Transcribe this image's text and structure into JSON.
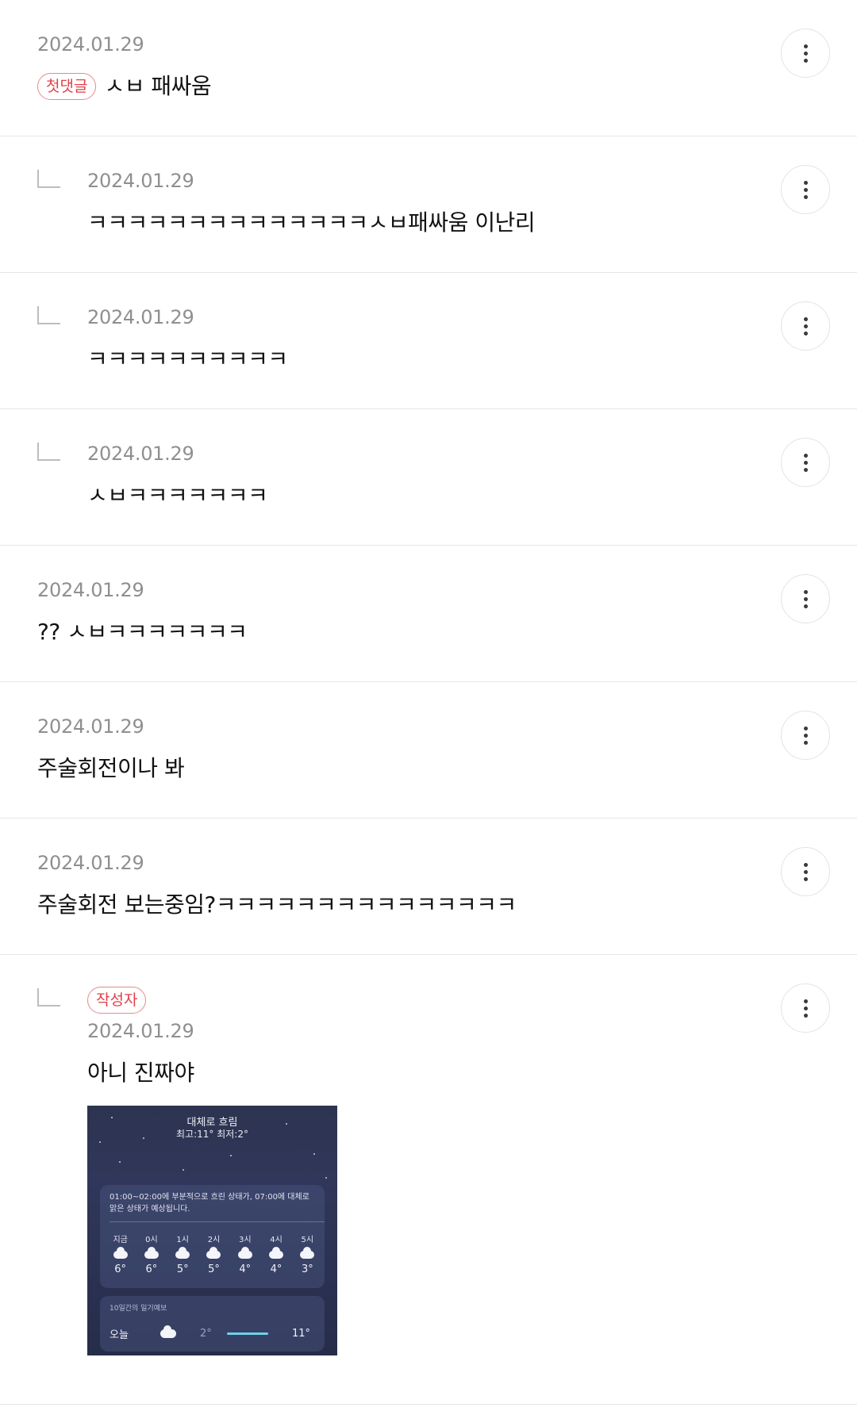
{
  "comments": [
    {
      "date": "2024.01.29",
      "badge": "첫댓글",
      "text": "ㅅㅂ 패싸움",
      "reply": false
    },
    {
      "date": "2024.01.29",
      "text": "ㅋㅋㅋㅋㅋㅋㅋㅋㅋㅋㅋㅋㅋㅋㅅㅂ패싸움 이난리",
      "reply": true
    },
    {
      "date": "2024.01.29",
      "text": "ㅋㅋㅋㅋㅋㅋㅋㅋㅋㅋ",
      "reply": true
    },
    {
      "date": "2024.01.29",
      "text": "ㅅㅂㅋㅋㅋㅋㅋㅋㅋ",
      "reply": true
    },
    {
      "date": "2024.01.29",
      "text": "?? ㅅㅂㅋㅋㅋㅋㅋㅋㅋ",
      "reply": false
    },
    {
      "date": "2024.01.29",
      "text": "주술회전이나 봐",
      "reply": false
    },
    {
      "date": "2024.01.29",
      "text": "주술회전 보는중임?ㅋㅋㅋㅋㅋㅋㅋㅋㅋㅋㅋㅋㅋㅋㅋ",
      "reply": false
    },
    {
      "date": "2024.01.29",
      "badge": "작성자",
      "text": "아니 진짜야",
      "reply": true
    }
  ],
  "weather": {
    "condition": "대체로 흐림",
    "hilo": "최고:11°  최저:2°",
    "summary": "01:00~02:00에 부분적으로 흐린 상태가, 07:00에 대체로 맑은 상태가 예상됩니다.",
    "hours": [
      {
        "label": "지금",
        "temp": "6°"
      },
      {
        "label": "0시",
        "temp": "6°"
      },
      {
        "label": "1시",
        "temp": "5°"
      },
      {
        "label": "2시",
        "temp": "5°"
      },
      {
        "label": "3시",
        "temp": "4°"
      },
      {
        "label": "4시",
        "temp": "4°"
      },
      {
        "label": "5시",
        "temp": "3°"
      }
    ],
    "forecast_label": "10일간의 일기예보",
    "today": {
      "day": "오늘",
      "low": "2°",
      "high": "11°"
    }
  },
  "colors": {
    "badge": "#e0404a",
    "date": "#8f8f8f",
    "divider": "#e6e6e6"
  },
  "icons": {
    "more": "more-vertical-icon",
    "reply": "reply-arrow-icon"
  }
}
